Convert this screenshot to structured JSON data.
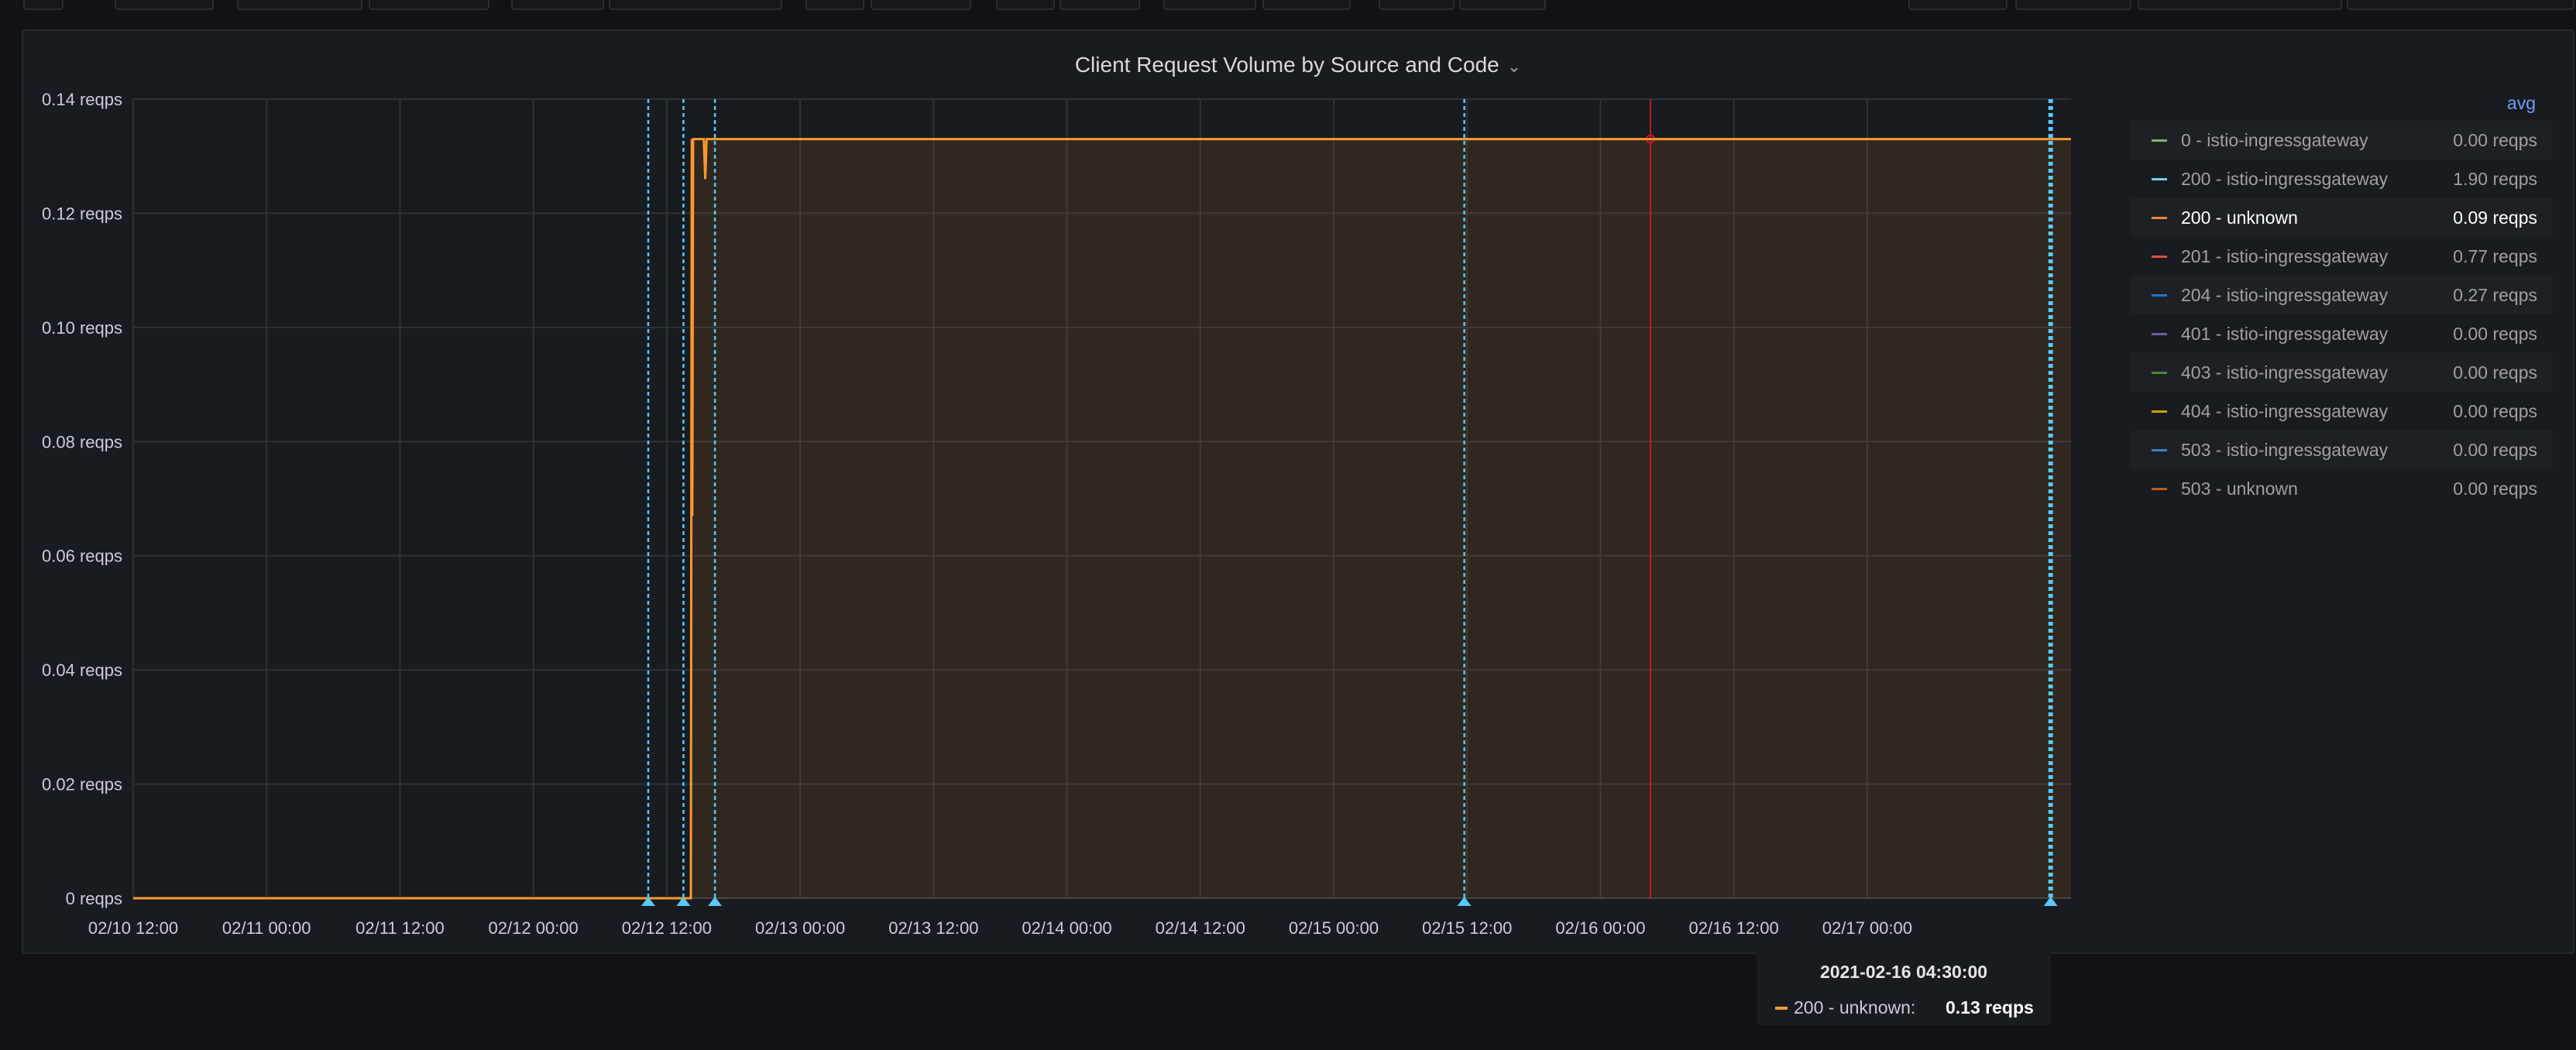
{
  "panel": {
    "title": "Client Request Volume by Source and Code"
  },
  "legend": {
    "header": "avg",
    "items": [
      {
        "name": "0 - istio-ingressgateway",
        "value": "0.00 reqps",
        "color": "#7eb26d"
      },
      {
        "name": "200 - istio-ingressgateway",
        "value": "1.90 reqps",
        "color": "#6ed0e0"
      },
      {
        "name": "200 - unknown",
        "value": "0.09 reqps",
        "color": "#ef843c"
      },
      {
        "name": "201 - istio-ingressgateway",
        "value": "0.77 reqps",
        "color": "#e24d42"
      },
      {
        "name": "204 - istio-ingressgateway",
        "value": "0.27 reqps",
        "color": "#1f78c1"
      },
      {
        "name": "401 - istio-ingressgateway",
        "value": "0.00 reqps",
        "color": "#705da0"
      },
      {
        "name": "403 - istio-ingressgateway",
        "value": "0.00 reqps",
        "color": "#508642"
      },
      {
        "name": "404 - istio-ingressgateway",
        "value": "0.00 reqps",
        "color": "#cca300"
      },
      {
        "name": "503 - istio-ingressgateway",
        "value": "0.00 reqps",
        "color": "#447ebc"
      },
      {
        "name": "503 - unknown",
        "value": "0.00 reqps",
        "color": "#c15c17"
      }
    ]
  },
  "tooltip": {
    "time": "2021-02-16 04:30:00",
    "series": "200 - unknown:",
    "value": "0.13 reqps"
  },
  "chart_data": {
    "type": "area",
    "y_ticks": [
      {
        "value": 0,
        "label": "0 reqps"
      },
      {
        "value": 0.02,
        "label": "0.02 reqps"
      },
      {
        "value": 0.04,
        "label": "0.04 reqps"
      },
      {
        "value": 0.06,
        "label": "0.06 reqps"
      },
      {
        "value": 0.08,
        "label": "0.08 reqps"
      },
      {
        "value": 0.1,
        "label": "0.10 reqps"
      },
      {
        "value": 0.12,
        "label": "0.12 reqps"
      },
      {
        "value": 0.14,
        "label": "0.14 reqps"
      }
    ],
    "ylim": [
      0,
      0.14
    ],
    "xlim": [
      "2021-02-10 12:00",
      "2021-02-17 18:20"
    ],
    "x_ticks": [
      "02/10 12:00",
      "02/11 00:00",
      "02/11 12:00",
      "02/12 00:00",
      "02/12 12:00",
      "02/13 00:00",
      "02/13 12:00",
      "02/14 00:00",
      "02/14 12:00",
      "02/15 00:00",
      "02/15 12:00",
      "02/16 00:00",
      "02/16 12:00",
      "02/17 00:00"
    ],
    "grid": true,
    "legend_position": "right",
    "series": [
      {
        "name": "200 - unknown",
        "color": "#ff9830",
        "points": [
          [
            "2021-02-10 12:00",
            0
          ],
          [
            "2021-02-12 14:00",
            0
          ],
          [
            "2021-02-12 14:10",
            0
          ],
          [
            "2021-02-12 14:15",
            0.133
          ],
          [
            "2021-02-12 14:18",
            0.067
          ],
          [
            "2021-02-12 14:22",
            0.133
          ],
          [
            "2021-02-12 15:20",
            0.133
          ],
          [
            "2021-02-12 15:28",
            0.126
          ],
          [
            "2021-02-12 15:35",
            0.133
          ],
          [
            "2021-02-17 18:20",
            0.133
          ]
        ]
      }
    ],
    "annotations": [
      "2021-02-12 10:20",
      "2021-02-12 13:30",
      "2021-02-12 16:20",
      "2021-02-15 11:45",
      "2021-02-17 16:30"
    ],
    "hover_time": "2021-02-16 04:30",
    "hover_value": 0.133
  }
}
